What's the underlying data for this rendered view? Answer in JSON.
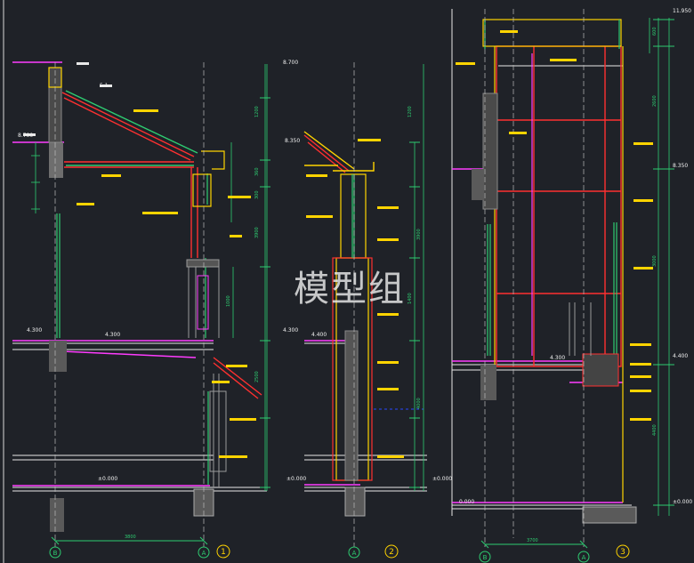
{
  "watermark": "模型组",
  "colors": {
    "background": "#1f2228",
    "frame": "#e8e8e8",
    "dim": "#2ecc71",
    "wall": "#ffd400",
    "red": "#ff3030",
    "magenta": "#ff3cff",
    "pink": "#ff80b0",
    "grey": "#8a8a8a",
    "cyan": "#2ad4ff",
    "white": "#f0f0f0"
  },
  "sections": [
    {
      "marker": "1",
      "grid_left": "B",
      "grid_right": "A",
      "span": "3800"
    },
    {
      "marker": "2",
      "grid_left": "",
      "grid_right": "A",
      "span": ""
    },
    {
      "marker": "3",
      "grid_left": "B",
      "grid_right": "A",
      "span": "3700"
    }
  ],
  "levels": {
    "s1": [
      "8.700",
      "5.1",
      "4.300",
      "4.300",
      "±0.000"
    ],
    "s2": [
      "8.350",
      "8.700",
      "4.300",
      "4.400",
      "±0.000",
      "±0.000"
    ],
    "s3": [
      "11.950",
      "8.350",
      "4.400",
      "4.300",
      "0.000",
      "±0.000"
    ]
  },
  "dims": {
    "s1_right": [
      "1200",
      "360",
      "300",
      "3900",
      "1000",
      "2500"
    ],
    "s2_mid": [
      "1200",
      "1400",
      "3900",
      "4000"
    ],
    "s3_right": [
      "600",
      "2600",
      "3000",
      "4400"
    ]
  }
}
